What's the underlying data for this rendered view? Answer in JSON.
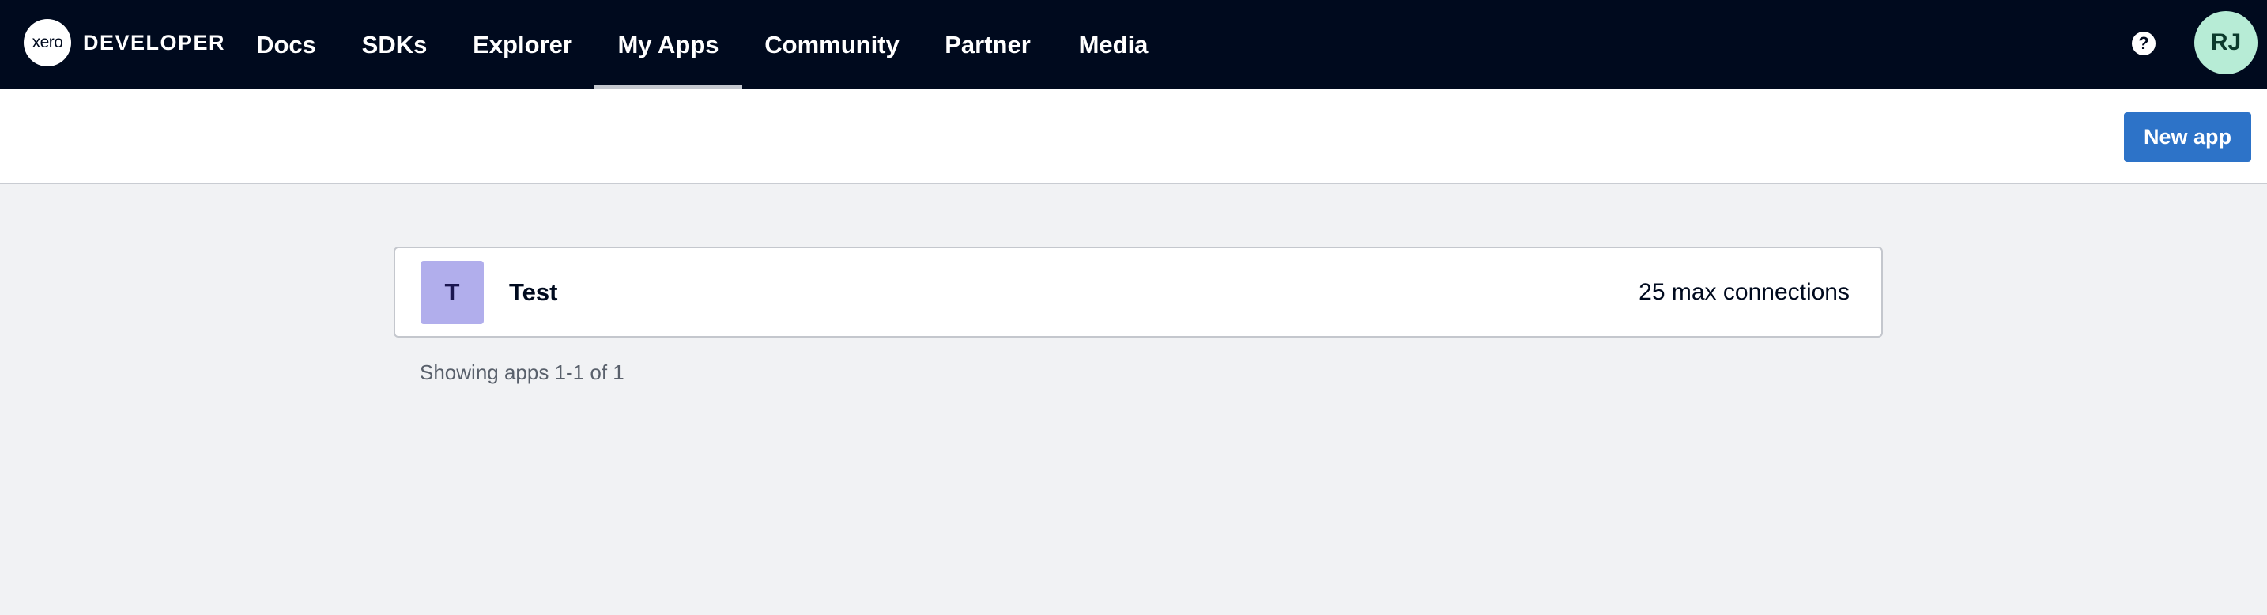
{
  "brand": {
    "logo_text": "xero",
    "name": "DEVELOPER"
  },
  "nav": {
    "items": [
      {
        "label": "Docs"
      },
      {
        "label": "SDKs"
      },
      {
        "label": "Explorer"
      },
      {
        "label": "My Apps",
        "active": true
      },
      {
        "label": "Community"
      },
      {
        "label": "Partner"
      },
      {
        "label": "Media"
      }
    ],
    "help_icon": "?",
    "avatar_initials": "RJ"
  },
  "toolbar": {
    "new_app_label": "New app"
  },
  "apps": [
    {
      "initial": "T",
      "name": "Test",
      "connections": "25 max connections"
    }
  ],
  "pagination": {
    "text": "Showing apps 1-1 of 1"
  },
  "colors": {
    "nav_background": "#000a1e",
    "primary_button": "#2d73c8",
    "avatar_background": "#b7ecd6",
    "app_tile_background": "#b1aeec",
    "page_background": "#f1f2f4"
  }
}
